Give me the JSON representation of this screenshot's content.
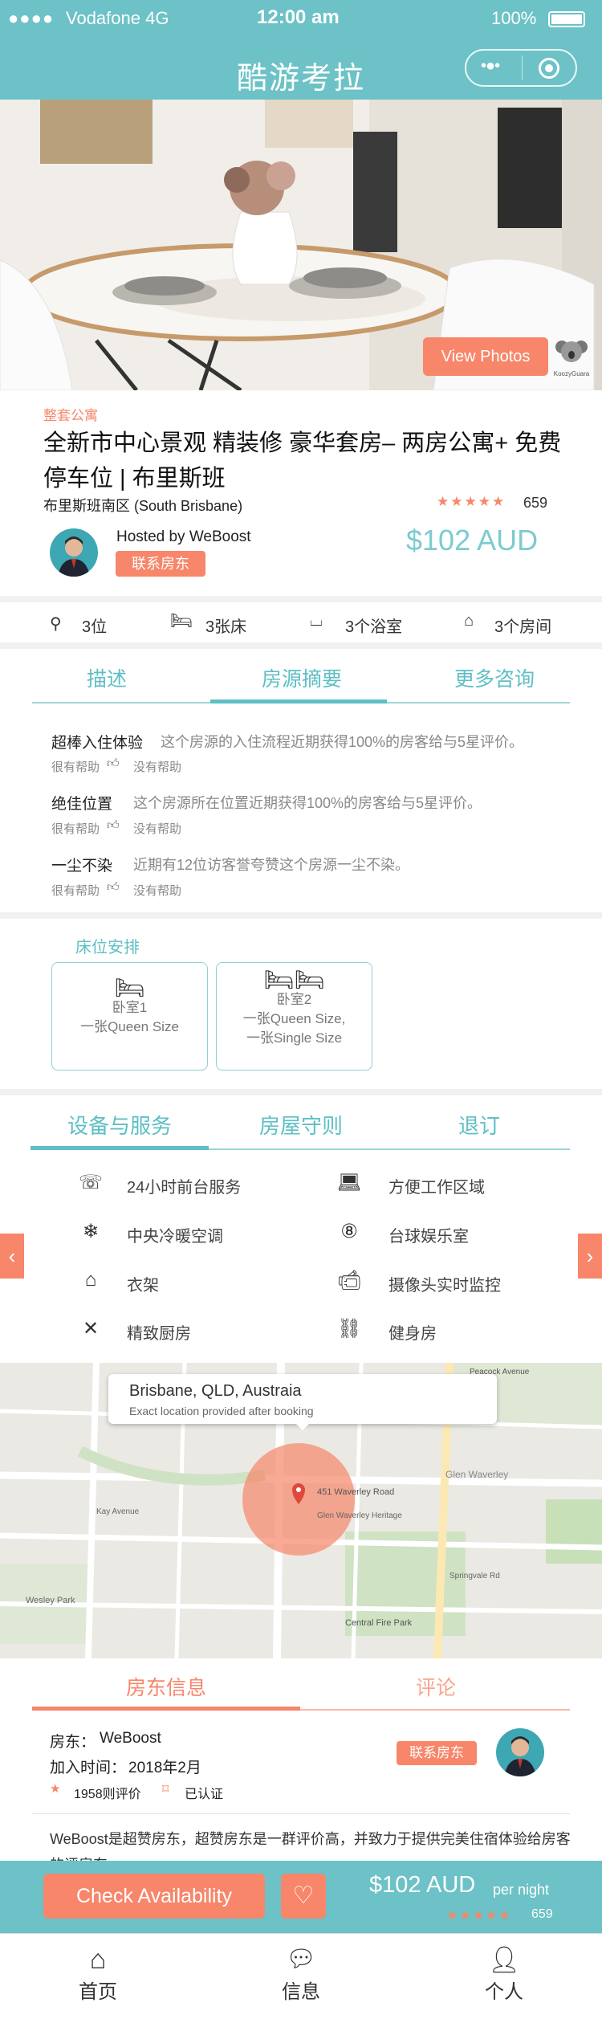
{
  "status": {
    "carrier": "Vodafone 4G",
    "time": "12:00 am",
    "battery": "100%"
  },
  "nav": {
    "title": "酷游考拉"
  },
  "hero": {
    "view_photos": "View Photos",
    "logo_text": "KoozyGuara"
  },
  "listing": {
    "type": "整套公寓",
    "title": "全新市中心景观 精装修 豪华套房– 两房公寓+ 免费停车位 | 布里斯班",
    "location": "布里斯班南区 (South Brisbane)",
    "rating_count": "659",
    "stars": 5,
    "host_label": "Hosted by WeBoost",
    "contact_button": "联系房东",
    "price": "$102 AUD"
  },
  "features": [
    {
      "icon": "guests-icon",
      "label": "3位"
    },
    {
      "icon": "bed-icon",
      "label": "3张床"
    },
    {
      "icon": "bathtub-icon",
      "label": "3个浴室"
    },
    {
      "icon": "room-icon",
      "label": "3个房间"
    }
  ],
  "info_tabs": [
    {
      "label": "描述"
    },
    {
      "label": "房源摘要"
    },
    {
      "label": "更多咨询"
    }
  ],
  "highlights": [
    {
      "title": "超棒入住体验",
      "desc": "这个房源的入住流程近期获得100%的房客给与5星评价。",
      "helpful": "很有帮助",
      "not_helpful": "没有帮助"
    },
    {
      "title": "绝佳位置",
      "desc": "这个房源所在位置近期获得100%的房客给与5星评价。",
      "helpful": "很有帮助",
      "not_helpful": "没有帮助"
    },
    {
      "title": "一尘不染",
      "desc": "近期有12位访客誉夸赞这个房源一尘不染。",
      "helpful": "很有帮助",
      "not_helpful": "没有帮助"
    }
  ],
  "beds": {
    "title": "床位安排",
    "rooms": [
      {
        "name": "卧室1",
        "desc1": "一张Queen Size",
        "desc2": ""
      },
      {
        "name": "卧室2",
        "desc1": "一张Queen Size,",
        "desc2": "一张Single Size"
      }
    ]
  },
  "service_tabs": [
    {
      "label": "设备与服务"
    },
    {
      "label": "房屋守则"
    },
    {
      "label": "退订"
    }
  ],
  "amenities": [
    {
      "icon": "phone-24h-icon",
      "label": "24小时前台服务"
    },
    {
      "icon": "workspace-icon",
      "label": "方便工作区域"
    },
    {
      "icon": "snowflake-icon",
      "label": "中央冷暖空调"
    },
    {
      "icon": "billiards-icon",
      "label": "台球娱乐室"
    },
    {
      "icon": "hanger-icon",
      "label": "衣架"
    },
    {
      "icon": "camera-icon",
      "label": "摄像头实时监控"
    },
    {
      "icon": "kitchen-icon",
      "label": "精致厨房"
    },
    {
      "icon": "dumbbell-icon",
      "label": "健身房"
    }
  ],
  "map": {
    "popup_title": "Brisbane, QLD, Austraia",
    "popup_sub": "Exact location provided after booking",
    "labels": [
      "Peacock Avenue",
      "Glen Waverley",
      "451 Waverley Road",
      "Glen Waverley Heritage",
      "Central Fire Park",
      "Wesley Park",
      "Kay Avenue",
      "Springvale Rd"
    ]
  },
  "host_tabs": [
    {
      "label": "房东信息"
    },
    {
      "label": "评论"
    }
  ],
  "host": {
    "name_label": "房东：",
    "name": "WeBoost",
    "joined_label": "加入时间：",
    "joined": "2018年2月",
    "reviews": "1958则评价",
    "verified": "已认证",
    "contact_button": "联系房东",
    "bio": "WeBoost是超赞房东，超赞房东是一群评价高，并致力于提供完美住宿体验给房客的评房东。"
  },
  "booking": {
    "check_button": "Check Availability",
    "price": "$102 AUD",
    "per_night": "per night",
    "rating_count": "659"
  },
  "tabbar": [
    {
      "icon": "home-icon",
      "label": "首页"
    },
    {
      "icon": "message-icon",
      "label": "信息"
    },
    {
      "icon": "user-icon",
      "label": "个人"
    }
  ],
  "colors": {
    "teal": "#6cc2c6",
    "orange": "#f7866a",
    "teal_text": "#5ebfc4"
  }
}
